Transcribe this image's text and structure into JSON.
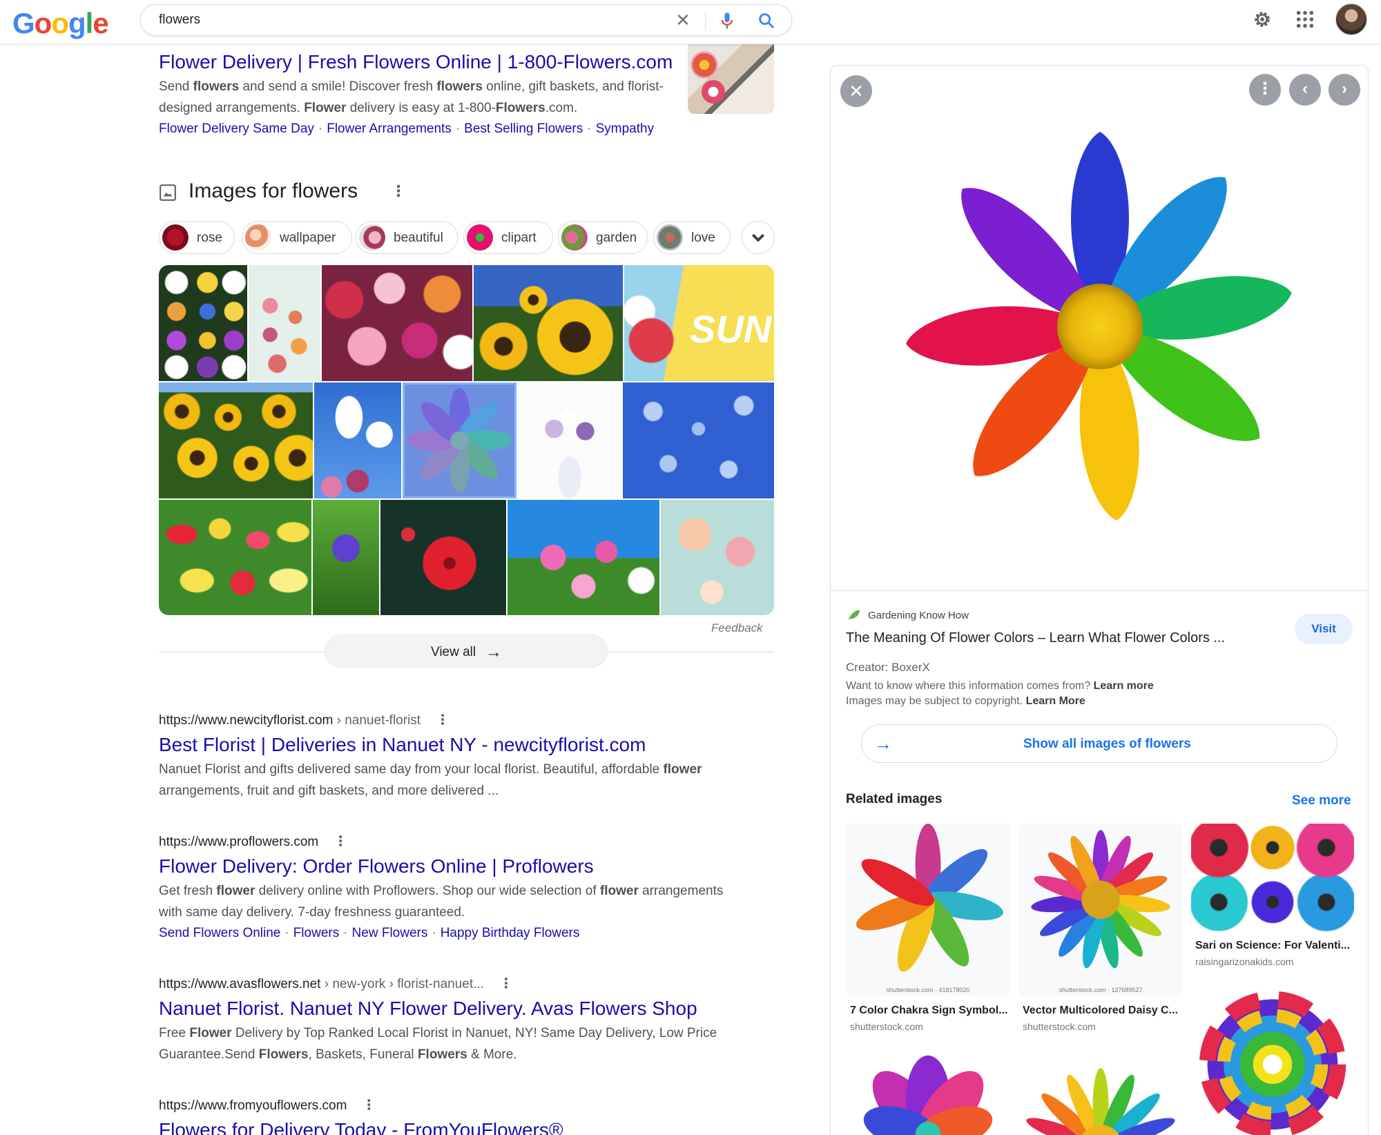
{
  "search": {
    "query": "flowers"
  },
  "logo": "Google",
  "results": [
    {
      "title": "Flower Delivery | Fresh Flowers Online | 1-800-Flowers.com",
      "snippet_parts": [
        "Send ",
        "flowers",
        " and send a smile! Discover fresh ",
        "flowers",
        " online, gift baskets, and florist-designed arrangements. ",
        "Flower",
        " delivery is easy at 1-800-",
        "Flowers",
        ".com."
      ],
      "links": [
        "Flower Delivery Same Day",
        "Flower Arrangements",
        "Best Selling Flowers",
        "Sympathy"
      ]
    },
    {
      "url": "https://www.newcityflorist.com",
      "crumb": " › nanuet-florist",
      "title": "Best Florist | Deliveries in Nanuet NY - newcityflorist.com",
      "snippet_parts": [
        "Nanuet Florist and gifts delivered same day from your local florist. Beautiful, affordable ",
        "flower",
        " arrangements, fruit and gift baskets, and more delivered ..."
      ]
    },
    {
      "url": "https://www.proflowers.com",
      "crumb": "",
      "title": "Flower Delivery: Order Flowers Online | Proflowers",
      "snippet_parts": [
        "Get fresh ",
        "flower",
        " delivery online with Proflowers. Shop our wide selection of ",
        "flower",
        " arrangements with same day delivery. 7-day freshness guaranteed."
      ],
      "links": [
        "Send Flowers Online",
        "Flowers",
        "New Flowers",
        "Happy Birthday Flowers"
      ]
    },
    {
      "url": "https://www.avasflowers.net",
      "crumb": " › new-york › florist-nanuet...",
      "title": "Nanuet Florist. Nanuet NY Flower Delivery. Avas Flowers Shop",
      "snippet_parts": [
        "Free ",
        "Flower",
        " Delivery by Top Ranked Local Florist in Nanuet, NY! Same Day Delivery, Low Price Guarantee.Send ",
        "Flowers",
        ", Baskets, Funeral ",
        "Flowers",
        " & More."
      ]
    },
    {
      "url": "https://www.fromyouflowers.com",
      "crumb": "",
      "title": "Flowers for Delivery Today - FromYouFlowers®"
    }
  ],
  "images_section": {
    "heading": "Images for flowers",
    "chips": [
      "rose",
      "wallpaper",
      "beautiful",
      "clipart",
      "garden",
      "love"
    ],
    "feedback": "Feedback",
    "view_all": "View all"
  },
  "panel": {
    "source": "Gardening Know How",
    "title": "The Meaning Of Flower Colors – Learn What Flower Colors ...",
    "visit": "Visit",
    "creator": "Creator: BoxerX",
    "info1_text": "Want to know where this information comes from? ",
    "info1_link": "Learn more",
    "info2_text": "Images may be subject to copyright. ",
    "info2_link": "Learn More",
    "show_all": "Show all images of flowers",
    "related_heading": "Related images",
    "see_more": "See more",
    "related": [
      {
        "caption": "7 Color Chakra Sign Symbol...",
        "domain": "shutterstock.com",
        "watermark": "shutterstock.com · 418178020"
      },
      {
        "caption": "Vector Multicolored Daisy C...",
        "domain": "shutterstock.com",
        "watermark": "shutterstock.com · 127689527"
      },
      {
        "caption": "Sari on Science: For Valenti...",
        "domain": "raisingarizonakids.com"
      }
    ]
  },
  "icons": [
    "clear-icon",
    "mic-icon",
    "search-icon",
    "gear-icon",
    "apps-icon",
    "image-icon",
    "more-vert-icon",
    "chevron-down-icon",
    "arrow-right-icon",
    "close-icon",
    "chevron-left-icon",
    "chevron-right-icon",
    "leaf-icon"
  ],
  "colors": {
    "link": "#1a0dab",
    "accent": "#1a73e8",
    "text": "#202124",
    "muted": "#4d5156"
  }
}
